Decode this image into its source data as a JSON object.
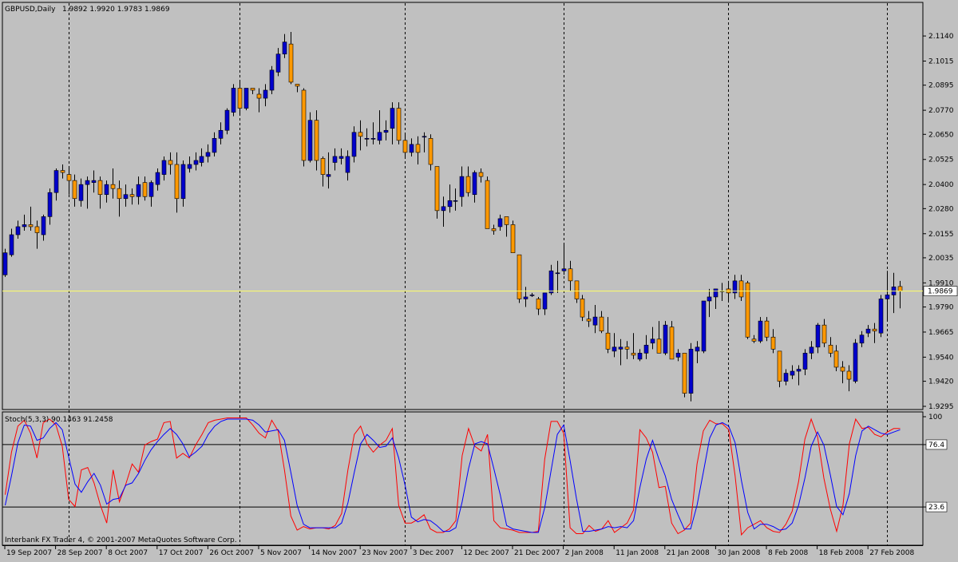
{
  "header": {
    "symbol": "GBPUSD,Daily",
    "ohlc": "1.9892 1.9920 1.9783 1.9869"
  },
  "colors": {
    "background": "#c0c0c0",
    "bull": "#0000cc",
    "bear": "#ff9900",
    "wick": "#000000",
    "price_line": "#ffff66",
    "stoch_main": "#ff0000",
    "stoch_signal": "#0000ff",
    "level_line": "#000000"
  },
  "footer": {
    "copyright": "Interbank FX Trader 4, © 2001-2007 MetaQuotes Software Corp."
  },
  "chart_data": [
    {
      "type": "candlestick",
      "title": "GBPUSD,Daily",
      "ylim": [
        1.9295,
        2.12
      ],
      "y_ticks": [
        "2.1140",
        "2.1015",
        "2.0895",
        "2.0770",
        "2.0650",
        "2.0525",
        "2.0400",
        "2.0280",
        "2.0155",
        "2.0035",
        "1.9910",
        "1.9790",
        "1.9665",
        "1.9540",
        "1.9420",
        "1.9295"
      ],
      "current_price_label": "1.9869",
      "current_price": 1.9869,
      "x_tick_labels": [
        "19 Sep 2007",
        "28 Sep 2007",
        "8 Oct 2007",
        "17 Oct 2007",
        "26 Oct 2007",
        "5 Nov 2007",
        "14 Nov 2007",
        "23 Nov 2007",
        "3 Dec 2007",
        "12 Dec 2007",
        "21 Dec 2007",
        "2 Jan 2008",
        "11 Jan 2008",
        "21 Jan 2008",
        "30 Jan 2008",
        "8 Feb 2008",
        "18 Feb 2008",
        "27 Feb 2008"
      ],
      "x_tick_bar_index": [
        0,
        8,
        16,
        24,
        32,
        40,
        48,
        56,
        64,
        72,
        80,
        88,
        96,
        104,
        112,
        120,
        128,
        136
      ],
      "period_separator_bar_index": [
        10,
        37,
        63,
        88,
        114,
        139
      ],
      "grid": false,
      "ohlc": [
        [
          1.995,
          2.008,
          1.994,
          2.006
        ],
        [
          2.005,
          2.018,
          2.004,
          2.015
        ],
        [
          2.015,
          2.022,
          2.013,
          2.019
        ],
        [
          2.019,
          2.025,
          2.017,
          2.02
        ],
        [
          2.02,
          2.029,
          2.017,
          2.019
        ],
        [
          2.019,
          2.022,
          2.008,
          2.016
        ],
        [
          2.015,
          2.025,
          2.012,
          2.024
        ],
        [
          2.024,
          2.038,
          2.02,
          2.036
        ],
        [
          2.036,
          2.048,
          2.032,
          2.047
        ],
        [
          2.047,
          2.05,
          2.043,
          2.046
        ],
        [
          2.045,
          2.048,
          2.035,
          2.042
        ],
        [
          2.042,
          2.045,
          2.029,
          2.033
        ],
        [
          2.032,
          2.043,
          2.029,
          2.04
        ],
        [
          2.04,
          2.044,
          2.028,
          2.042
        ],
        [
          2.041,
          2.047,
          2.036,
          2.042
        ],
        [
          2.042,
          2.044,
          2.028,
          2.035
        ],
        [
          2.035,
          2.042,
          2.031,
          2.04
        ],
        [
          2.04,
          2.048,
          2.033,
          2.038
        ],
        [
          2.038,
          2.042,
          2.024,
          2.033
        ],
        [
          2.033,
          2.04,
          2.029,
          2.035
        ],
        [
          2.035,
          2.038,
          2.03,
          2.034
        ],
        [
          2.034,
          2.044,
          2.03,
          2.04
        ],
        [
          2.041,
          2.044,
          2.032,
          2.034
        ],
        [
          2.034,
          2.042,
          2.029,
          2.041
        ],
        [
          2.04,
          2.048,
          2.037,
          2.046
        ],
        [
          2.045,
          2.054,
          2.042,
          2.052
        ],
        [
          2.052,
          2.056,
          2.045,
          2.05
        ],
        [
          2.05,
          2.056,
          2.026,
          2.033
        ],
        [
          2.033,
          2.052,
          2.029,
          2.05
        ],
        [
          2.048,
          2.054,
          2.046,
          2.05
        ],
        [
          2.05,
          2.056,
          2.047,
          2.052
        ],
        [
          2.051,
          2.058,
          2.049,
          2.054
        ],
        [
          2.054,
          2.06,
          2.051,
          2.056
        ],
        [
          2.056,
          2.066,
          2.054,
          2.063
        ],
        [
          2.063,
          2.071,
          2.06,
          2.067
        ],
        [
          2.067,
          2.078,
          2.065,
          2.077
        ],
        [
          2.076,
          2.09,
          2.074,
          2.088
        ],
        [
          2.088,
          2.091,
          2.075,
          2.078
        ],
        [
          2.078,
          2.088,
          2.077,
          2.088
        ],
        [
          2.088,
          2.088,
          2.085,
          2.087
        ],
        [
          2.085,
          2.088,
          2.076,
          2.083
        ],
        [
          2.083,
          2.09,
          2.079,
          2.087
        ],
        [
          2.087,
          2.099,
          2.085,
          2.097
        ],
        [
          2.096,
          2.108,
          2.094,
          2.105
        ],
        [
          2.105,
          2.115,
          2.103,
          2.111
        ],
        [
          2.11,
          2.116,
          2.09,
          2.091
        ],
        [
          2.09,
          2.09,
          2.086,
          2.089
        ],
        [
          2.087,
          2.088,
          2.049,
          2.052
        ],
        [
          2.052,
          2.076,
          2.051,
          2.072
        ],
        [
          2.072,
          2.077,
          2.047,
          2.052
        ],
        [
          2.053,
          2.054,
          2.039,
          2.045
        ],
        [
          2.044,
          2.056,
          2.038,
          2.045
        ],
        [
          2.051,
          2.058,
          2.047,
          2.054
        ],
        [
          2.053,
          2.058,
          2.05,
          2.054
        ],
        [
          2.046,
          2.057,
          2.042,
          2.054
        ],
        [
          2.054,
          2.069,
          2.051,
          2.066
        ],
        [
          2.066,
          2.072,
          2.057,
          2.064
        ],
        [
          2.063,
          2.068,
          2.059,
          2.063
        ],
        [
          2.063,
          2.071,
          2.06,
          2.063
        ],
        [
          2.062,
          2.077,
          2.06,
          2.066
        ],
        [
          2.066,
          2.072,
          2.062,
          2.067
        ],
        [
          2.068,
          2.081,
          2.06,
          2.078
        ],
        [
          2.078,
          2.081,
          2.06,
          2.062
        ],
        [
          2.062,
          2.065,
          2.054,
          2.056
        ],
        [
          2.056,
          2.063,
          2.054,
          2.06
        ],
        [
          2.06,
          2.064,
          2.05,
          2.056
        ],
        [
          2.064,
          2.066,
          2.056,
          2.064
        ],
        [
          2.063,
          2.065,
          2.047,
          2.05
        ],
        [
          2.049,
          2.049,
          2.023,
          2.027
        ],
        [
          2.027,
          2.034,
          2.019,
          2.029
        ],
        [
          2.029,
          2.04,
          2.026,
          2.032
        ],
        [
          2.032,
          2.038,
          2.027,
          2.032
        ],
        [
          2.034,
          2.049,
          2.029,
          2.044
        ],
        [
          2.044,
          2.049,
          2.034,
          2.036
        ],
        [
          2.035,
          2.047,
          2.031,
          2.046
        ],
        [
          2.046,
          2.048,
          2.041,
          2.044
        ],
        [
          2.042,
          2.044,
          2.018,
          2.018
        ],
        [
          2.018,
          2.02,
          2.015,
          2.017
        ],
        [
          2.019,
          2.025,
          2.017,
          2.023
        ],
        [
          2.024,
          2.024,
          2.014,
          2.02
        ],
        [
          2.02,
          2.022,
          2.006,
          2.006
        ],
        [
          2.005,
          2.005,
          1.981,
          1.983
        ],
        [
          1.983,
          1.989,
          1.979,
          1.984
        ],
        [
          1.985,
          1.986,
          1.984,
          1.985
        ],
        [
          1.983,
          1.984,
          1.975,
          1.978
        ],
        [
          1.978,
          1.986,
          1.975,
          1.986
        ],
        [
          1.986,
          2.0,
          1.985,
          1.997
        ],
        [
          1.996,
          2.002,
          1.986,
          1.996
        ],
        [
          1.997,
          2.011,
          1.995,
          1.998
        ],
        [
          1.998,
          2.002,
          1.987,
          1.992
        ],
        [
          1.992,
          1.992,
          1.981,
          1.983
        ],
        [
          1.983,
          1.985,
          1.972,
          1.974
        ],
        [
          1.973,
          1.977,
          1.969,
          1.972
        ],
        [
          1.97,
          1.98,
          1.966,
          1.974
        ],
        [
          1.974,
          1.977,
          1.966,
          1.967
        ],
        [
          1.966,
          1.974,
          1.956,
          1.958
        ],
        [
          1.957,
          1.966,
          1.954,
          1.959
        ],
        [
          1.958,
          1.963,
          1.95,
          1.959
        ],
        [
          1.959,
          1.962,
          1.953,
          1.958
        ],
        [
          1.956,
          1.966,
          1.953,
          1.955
        ],
        [
          1.953,
          1.958,
          1.952,
          1.956
        ],
        [
          1.956,
          1.965,
          1.953,
          1.96
        ],
        [
          1.961,
          1.969,
          1.958,
          1.963
        ],
        [
          1.963,
          1.972,
          1.956,
          1.956
        ],
        [
          1.956,
          1.972,
          1.955,
          1.97
        ],
        [
          1.969,
          1.972,
          1.953,
          1.953
        ],
        [
          1.954,
          1.958,
          1.952,
          1.956
        ],
        [
          1.956,
          1.956,
          1.934,
          1.936
        ],
        [
          1.936,
          1.961,
          1.932,
          1.958
        ],
        [
          1.957,
          1.962,
          1.951,
          1.959
        ],
        [
          1.957,
          1.982,
          1.956,
          1.982
        ],
        [
          1.982,
          1.988,
          1.974,
          1.984
        ],
        [
          1.984,
          1.988,
          1.978,
          1.988
        ],
        [
          1.987,
          1.991,
          1.982,
          1.987
        ],
        [
          1.988,
          1.992,
          1.982,
          1.986
        ],
        [
          1.986,
          1.995,
          1.983,
          1.992
        ],
        [
          1.992,
          1.995,
          1.982,
          1.984
        ],
        [
          1.991,
          1.992,
          1.963,
          1.964
        ],
        [
          1.963,
          1.965,
          1.961,
          1.962
        ],
        [
          1.962,
          1.974,
          1.961,
          1.972
        ],
        [
          1.972,
          1.974,
          1.962,
          1.964
        ],
        [
          1.964,
          1.968,
          1.956,
          1.958
        ],
        [
          1.957,
          1.957,
          1.939,
          1.942
        ],
        [
          1.942,
          1.948,
          1.94,
          1.946
        ],
        [
          1.945,
          1.95,
          1.943,
          1.947
        ],
        [
          1.947,
          1.95,
          1.94,
          1.948
        ],
        [
          1.948,
          1.958,
          1.945,
          1.956
        ],
        [
          1.956,
          1.962,
          1.953,
          1.959
        ],
        [
          1.959,
          1.971,
          1.956,
          1.97
        ],
        [
          1.97,
          1.973,
          1.959,
          1.961
        ],
        [
          1.96,
          1.964,
          1.954,
          1.956
        ],
        [
          1.957,
          1.96,
          1.947,
          1.949
        ],
        [
          1.949,
          1.952,
          1.941,
          1.947
        ],
        [
          1.947,
          1.95,
          1.937,
          1.943
        ],
        [
          1.942,
          1.963,
          1.941,
          1.961
        ],
        [
          1.961,
          1.967,
          1.959,
          1.965
        ],
        [
          1.966,
          1.97,
          1.964,
          1.968
        ],
        [
          1.968,
          1.971,
          1.961,
          1.967
        ],
        [
          1.966,
          1.985,
          1.964,
          1.983
        ],
        [
          1.983,
          1.997,
          1.972,
          1.985
        ],
        [
          1.985,
          1.996,
          1.976,
          1.989
        ],
        [
          1.9892,
          1.992,
          1.9783,
          1.9869
        ]
      ]
    },
    {
      "type": "line",
      "title": "Stoch(5,3,3) 90.1463 91.2458",
      "ylim": [
        0,
        100
      ],
      "y_ticks": [
        "100",
        "76.4",
        "23.6"
      ],
      "levels": [
        76.4,
        23.6
      ],
      "grid": false,
      "series": [
        {
          "color": "#ff0000",
          "values": [
            34,
            70,
            92,
            97,
            86,
            65,
            95,
            98,
            93,
            75,
            30,
            24,
            55,
            57,
            44,
            25,
            10,
            55,
            28,
            43,
            60,
            53,
            76,
            79,
            81,
            95,
            96,
            65,
            69,
            65,
            76,
            85,
            95,
            97,
            98,
            99,
            99,
            99,
            99,
            93,
            86,
            82,
            97,
            88,
            55,
            16,
            4,
            7,
            5,
            6,
            6,
            5,
            8,
            18,
            55,
            85,
            92,
            77,
            70,
            76,
            80,
            90,
            25,
            10,
            10,
            13,
            17,
            5,
            2,
            2,
            5,
            12,
            67,
            90,
            75,
            71,
            85,
            12,
            6,
            5,
            4,
            2,
            2,
            2,
            3,
            64,
            96,
            96,
            86,
            6,
            1,
            1,
            8,
            3,
            5,
            12,
            2,
            6,
            10,
            21,
            89,
            82,
            70,
            40,
            41,
            10,
            1,
            4,
            10,
            60,
            88,
            97,
            94,
            94,
            89,
            50,
            0,
            6,
            9,
            12,
            6,
            3,
            2,
            9,
            20,
            45,
            81,
            98,
            83,
            48,
            22,
            3,
            25,
            77,
            98,
            90,
            91,
            85,
            83,
            87,
            90,
            90
          ]
        },
        {
          "color": "#0000ff",
          "values": [
            25,
            50,
            78,
            93,
            92,
            80,
            82,
            90,
            95,
            89,
            66,
            43,
            36,
            45,
            52,
            42,
            26,
            30,
            31,
            42,
            44,
            52,
            63,
            72,
            79,
            85,
            90,
            85,
            77,
            66,
            70,
            75,
            85,
            92,
            96,
            98,
            98,
            98,
            98,
            97,
            93,
            87,
            88,
            89,
            80,
            53,
            25,
            9,
            6,
            6,
            6,
            6,
            6,
            10,
            27,
            53,
            77,
            85,
            80,
            74,
            75,
            82,
            65,
            42,
            15,
            11,
            13,
            12,
            8,
            3,
            3,
            6,
            28,
            56,
            77,
            79,
            77,
            56,
            34,
            8,
            5,
            4,
            3,
            2,
            2,
            23,
            54,
            85,
            93,
            63,
            31,
            3,
            3,
            4,
            5,
            7,
            6,
            7,
            6,
            12,
            40,
            64,
            80,
            64,
            50,
            30,
            17,
            5,
            5,
            25,
            53,
            82,
            93,
            95,
            92,
            78,
            46,
            19,
            5,
            9,
            9,
            7,
            4,
            5,
            10,
            25,
            48,
            75,
            87,
            76,
            51,
            24,
            17,
            35,
            67,
            88,
            92,
            89,
            86,
            85,
            87,
            89
          ]
        }
      ]
    }
  ]
}
